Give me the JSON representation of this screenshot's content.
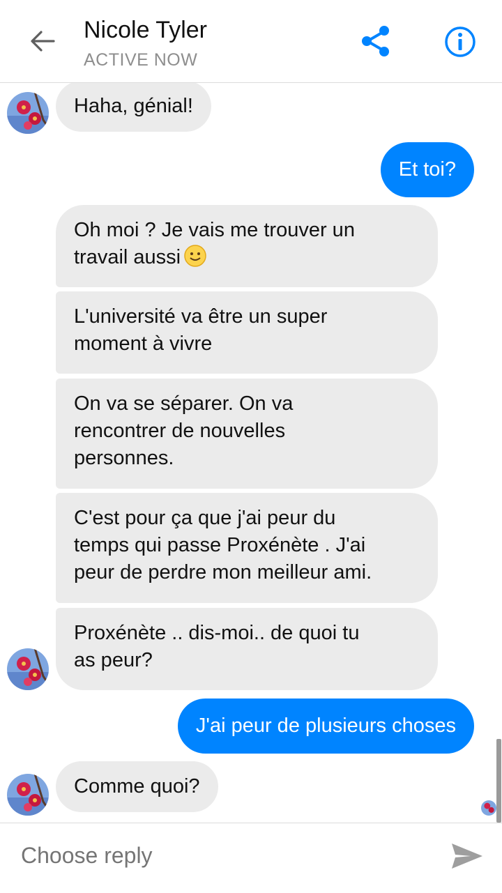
{
  "header": {
    "name": "Nicole Tyler",
    "status": "ACTIVE NOW",
    "icons": {
      "back": "arrow-left-icon",
      "share": "share-icon",
      "info": "info-icon"
    },
    "accent": "#0084ff"
  },
  "messages": [
    {
      "from": "contact",
      "text": "Haha, génial!"
    },
    {
      "from": "me",
      "text": "Et toi?"
    },
    {
      "from": "contact",
      "lines": [
        "Oh moi ? Je vais me trouver un",
        "travail aussi"
      ],
      "emoji": "slightly-smiling-face-icon"
    },
    {
      "from": "contact",
      "lines": [
        "L'université va être un super",
        "moment à vivre"
      ]
    },
    {
      "from": "contact",
      "lines": [
        "On va se séparer. On va",
        "rencontrer de nouvelles",
        "personnes."
      ]
    },
    {
      "from": "contact",
      "lines": [
        "C'est pour ça que j'ai peur du",
        "temps qui passe Proxénète . J'ai",
        "peur de perdre mon meilleur ami."
      ]
    },
    {
      "from": "contact",
      "lines": [
        "Proxénète .. dis-moi.. de quoi tu",
        "as peur?"
      ]
    },
    {
      "from": "me",
      "text": "J'ai peur de plusieurs choses"
    },
    {
      "from": "contact",
      "text": "Comme quoi?"
    }
  ],
  "composer": {
    "placeholder": "Choose reply",
    "send_icon": "send-icon"
  },
  "colors": {
    "incoming_bubble": "#ebebeb",
    "outgoing_bubble": "#0084ff",
    "status_text": "#8e8e8e"
  }
}
